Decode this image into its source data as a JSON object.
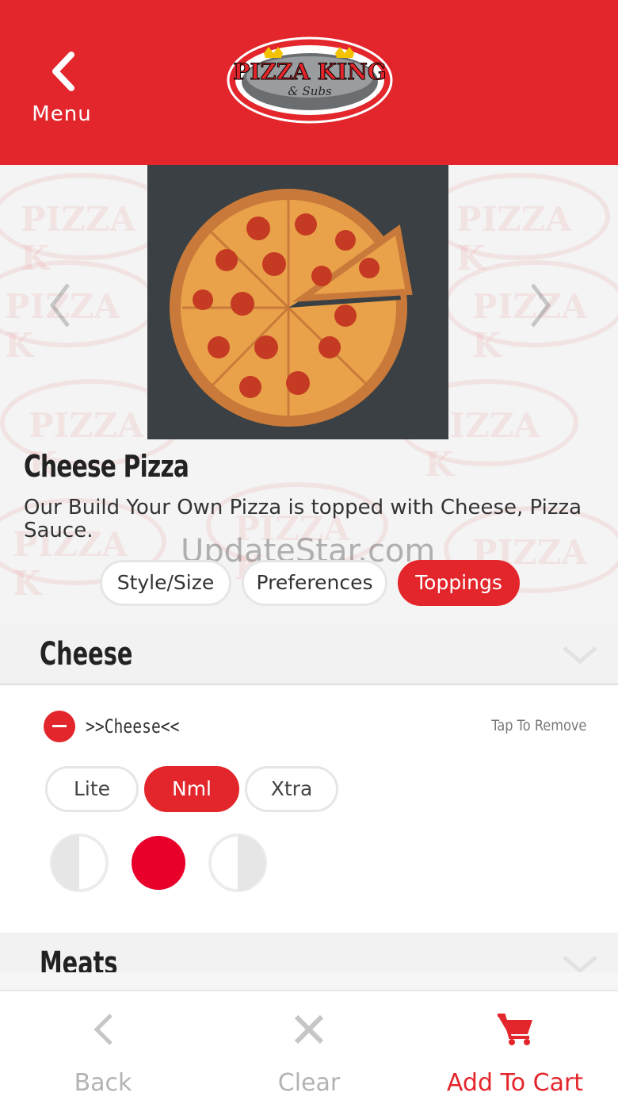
{
  "header": {
    "back_label": "Menu",
    "logo_text": "PIZZA KING",
    "logo_subtext": "& Subs",
    "brand_color": "#e3262b"
  },
  "product": {
    "title": "Cheese Pizza",
    "description": "Our Build Your Own Pizza is topped with Cheese, Pizza Sauce."
  },
  "watermark": "UpdateStar.com",
  "tabs": [
    {
      "label": "Style/Size",
      "active": false
    },
    {
      "label": "Preferences",
      "active": false
    },
    {
      "label": "Toppings",
      "active": true
    }
  ],
  "sections": {
    "cheese": "Cheese",
    "meats": "Meats"
  },
  "topping": {
    "name": ">>Cheese<<",
    "action_hint": "Tap To Remove",
    "amounts": [
      {
        "label": "Lite",
        "selected": false
      },
      {
        "label": "Nml",
        "selected": true
      },
      {
        "label": "Xtra",
        "selected": false
      }
    ],
    "portions": [
      "left-half",
      "whole",
      "right-half"
    ],
    "selected_portion": "whole"
  },
  "bottom_bar": {
    "back": "Back",
    "clear": "Clear",
    "add_to_cart": "Add To Cart"
  }
}
